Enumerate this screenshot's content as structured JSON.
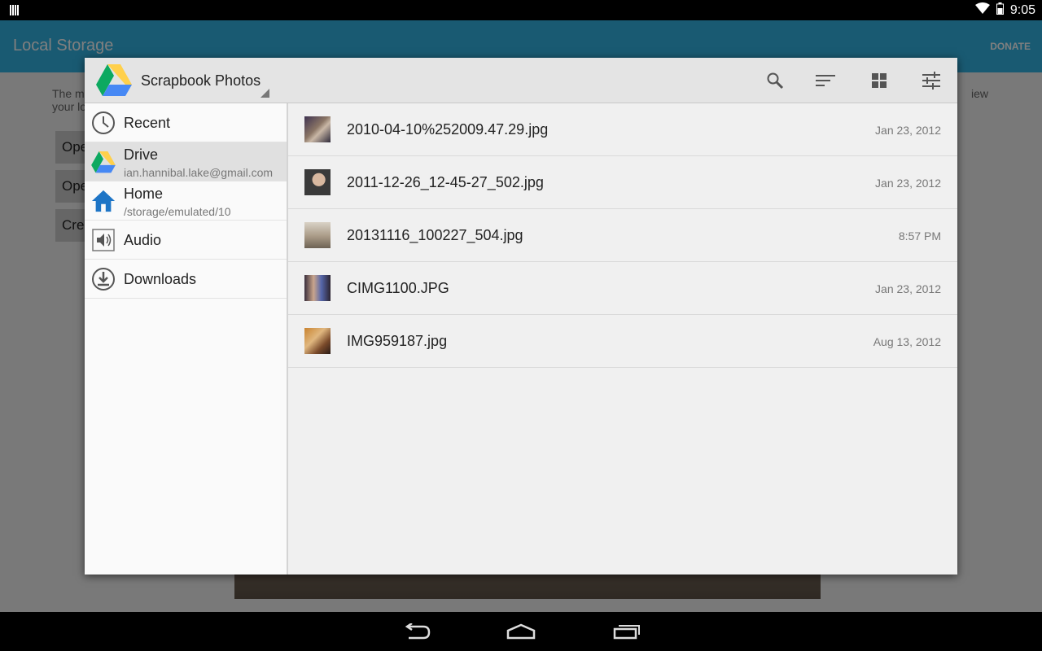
{
  "status_bar": {
    "time": "9:05"
  },
  "background_app": {
    "title": "Local Storage",
    "donate_label": "DONATE",
    "desc_left": "The m",
    "desc_left_2": "your lo",
    "desc_right": "iew",
    "buttons": [
      "Ope",
      "Ope",
      "Cre"
    ]
  },
  "dialog": {
    "title": "Scrapbook Photos",
    "roots": [
      {
        "title": "Recent",
        "summary": "",
        "icon": "clock-icon"
      },
      {
        "title": "Drive",
        "summary": "ian.hannibal.lake@gmail.com",
        "icon": "google-drive-icon",
        "selected": true
      },
      {
        "title": "Home",
        "summary": "/storage/emulated/10",
        "icon": "home-icon"
      },
      {
        "title": "Audio",
        "summary": "",
        "icon": "audio-icon"
      },
      {
        "title": "Downloads",
        "summary": "",
        "icon": "download-icon"
      }
    ],
    "files": [
      {
        "name": "2010-04-10%252009.47.29.jpg",
        "date": "Jan 23, 2012"
      },
      {
        "name": "2011-12-26_12-45-27_502.jpg",
        "date": "Jan 23, 2012"
      },
      {
        "name": "20131116_100227_504.jpg",
        "date": "8:57 PM"
      },
      {
        "name": "CIMG1100.JPG",
        "date": "Jan 23, 2012"
      },
      {
        "name": "IMG959187.jpg",
        "date": "Aug 13, 2012"
      }
    ]
  },
  "colors": {
    "action_bar": "#33b5e5",
    "drive_green": "#0da960",
    "drive_yellow": "#ffd04b",
    "drive_blue": "#4688f4",
    "home_blue": "#1e75c6"
  }
}
